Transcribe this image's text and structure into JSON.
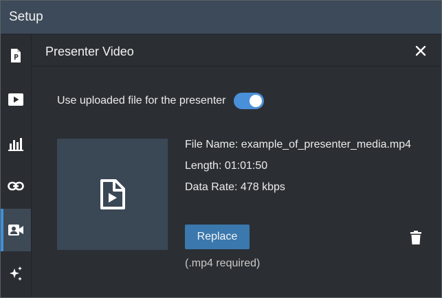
{
  "window": {
    "title": "Setup"
  },
  "sidebar": {
    "items": [
      {
        "icon": "presentation-file-icon",
        "active": false
      },
      {
        "icon": "play-video-icon",
        "active": false
      },
      {
        "icon": "bar-chart-icon",
        "active": false
      },
      {
        "icon": "link-icon",
        "active": false
      },
      {
        "icon": "presenter-camera-icon",
        "active": true
      },
      {
        "icon": "sparkles-icon",
        "active": false
      }
    ]
  },
  "panel": {
    "title": "Presenter Video",
    "toggle": {
      "label": "Use uploaded file for the presenter",
      "on": true
    },
    "file": {
      "name": "File Name: example_of_presenter_media.mp4",
      "length": "Length: 01:01:50",
      "data_rate": "Data Rate: 478 kbps"
    },
    "replace_label": "Replace",
    "requirement": "(.mp4 required)"
  },
  "colors": {
    "accent": "#4a90d9",
    "button": "#3a78ad",
    "titlebar": "#3c4a59"
  }
}
